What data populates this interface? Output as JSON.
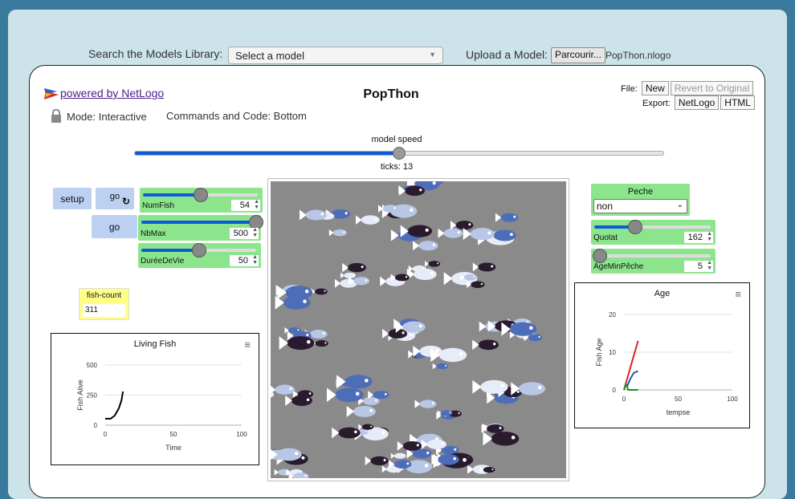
{
  "top_bar": {
    "search_label": "Search the Models Library:",
    "select_value": "Select a model",
    "upload_label": "Upload a Model:",
    "browse_label": "Parcourir...",
    "file_name": "PopThon.nlogo"
  },
  "header": {
    "powered_by": "powered by NetLogo",
    "title": "PopThon",
    "file_label": "File:",
    "new_label": "New",
    "revert_label": "Revert to Original",
    "export_label": "Export:",
    "netlogo_label": "NetLogo",
    "html_label": "HTML",
    "mode_text": "Mode: Interactive",
    "commands_text": "Commands and Code: Bottom"
  },
  "speed": {
    "label": "model speed",
    "value": 0.5,
    "ticks_text": "ticks: 13"
  },
  "buttons": {
    "setup": "setup",
    "go_forever": "go",
    "go_once": "go"
  },
  "sliders": [
    {
      "name": "NumFish",
      "value": "54",
      "fraction": 0.5
    },
    {
      "name": "NbMax",
      "value": "500",
      "fraction": 1.0
    },
    {
      "name": "DuréeDeVie",
      "value": "50",
      "fraction": 0.5
    },
    {
      "name": "Quotat",
      "value": "162",
      "fraction": 0.35
    },
    {
      "name": "AgeMinPêche",
      "value": "5",
      "fraction": 0.05
    }
  ],
  "monitor": {
    "label": "fish-count",
    "value": "311"
  },
  "chooser": {
    "label": "Peche",
    "value": "non"
  },
  "plot_living": {
    "title": "Living Fish",
    "xlabel": "Time",
    "ylabel": "Fish Alive"
  },
  "plot_age": {
    "title": "Age",
    "xlabel": "tempse",
    "ylabel": "Fish Age"
  },
  "colors": {
    "accent": "#0b5cd6",
    "slider_bg": "#8ce58c",
    "button_bg": "#bcd0f2",
    "monitor_bg": "#ffff88",
    "view_bg": "#8a8a8a"
  },
  "chart_data": [
    {
      "type": "line",
      "title": "Living Fish",
      "xlabel": "Time",
      "ylabel": "Fish Alive",
      "xlim": [
        0,
        100
      ],
      "ylim": [
        0,
        500
      ],
      "x_ticks": [
        "0",
        "50",
        "100"
      ],
      "y_ticks": [
        "0",
        "250",
        "500"
      ],
      "series": [
        {
          "color": "#000000",
          "x": [
            0,
            4,
            7,
            10,
            12,
            13
          ],
          "y": [
            54,
            54,
            80,
            140,
            210,
            280
          ]
        }
      ]
    },
    {
      "type": "line",
      "title": "Age",
      "xlabel": "tempse",
      "ylabel": "Fish Age",
      "xlim": [
        0,
        100
      ],
      "ylim": [
        0,
        20
      ],
      "x_ticks": [
        "0",
        "50",
        "100"
      ],
      "y_ticks": [
        "0",
        "10",
        "20"
      ],
      "series": [
        {
          "color": "#dd2222",
          "x": [
            0,
            13
          ],
          "y": [
            0,
            13
          ]
        },
        {
          "color": "#2255aa",
          "x": [
            3,
            6,
            9,
            13
          ],
          "y": [
            1,
            3,
            4.5,
            5
          ]
        },
        {
          "color": "#228822",
          "x": [
            0,
            2,
            4,
            13
          ],
          "y": [
            0,
            1.5,
            0,
            0
          ]
        }
      ]
    }
  ]
}
